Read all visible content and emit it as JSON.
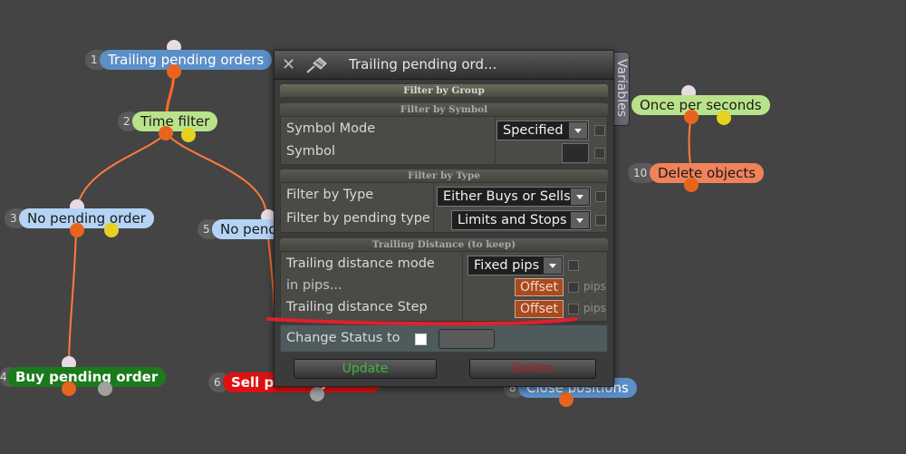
{
  "nodes": {
    "n1": {
      "num": "1",
      "label": "Trailing pending orders"
    },
    "n2": {
      "num": "2",
      "label": "Time filter"
    },
    "n3": {
      "num": "3",
      "label": "No pending order"
    },
    "n4": {
      "num": "4",
      "label": "Buy pending order"
    },
    "n5": {
      "num": "5",
      "label": "No pend"
    },
    "n6": {
      "num": "6",
      "label": "Sell pending order"
    },
    "n8": {
      "num": "8",
      "label": "Close positions"
    },
    "n9": {
      "label": "Once per seconds"
    },
    "n10": {
      "num": "10",
      "label": "Delete objects"
    }
  },
  "dialog": {
    "title": "Trailing pending ord...",
    "variables_tab": "Variables",
    "filter_by_group": "Filter by Group",
    "sections": {
      "symbol": {
        "header": "Filter by Symbol",
        "symbol_mode_label": "Symbol Mode",
        "symbol_mode_value": "Specified",
        "symbol_label": "Symbol"
      },
      "type": {
        "header": "Filter by Type",
        "filter_type_label": "Filter by Type",
        "filter_type_value": "Either Buys or Sells",
        "pending_type_label": "Filter by pending type",
        "pending_type_value": "Limits and Stops"
      },
      "trailing": {
        "header": "Trailing Distance (to keep)",
        "mode_label": "Trailing distance mode",
        "mode_value": "Fixed pips",
        "pips_label": "in pips...",
        "pips_button": "Offset",
        "pips_unit": "pips",
        "step_label": "Trailing distance Step",
        "step_button": "Offset",
        "step_unit": "pips"
      }
    },
    "change_status_label": "Change Status to",
    "update_button": "Update",
    "delete_button": "Delete"
  },
  "colors": {
    "background": "#444444",
    "blue_node": "#5b8fc7",
    "green_node": "#b9e38a",
    "light_blue_node": "#b5d4f5",
    "buy_node": "#1b7a1b",
    "sell_node": "#e01010",
    "orange_node": "#f0825a",
    "update_text": "#3fb63f",
    "delete_text": "#b21d1d",
    "annotation": "#e0202c"
  }
}
